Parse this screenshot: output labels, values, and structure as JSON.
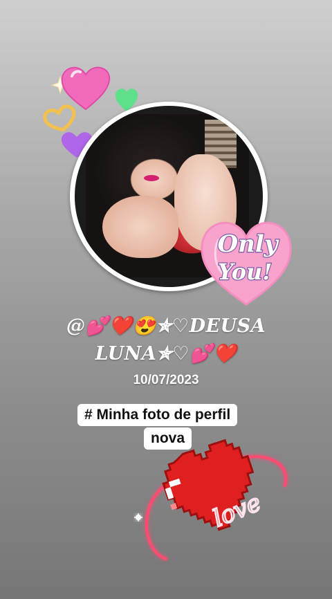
{
  "story": {
    "handle_line1": "@💕❤️😍✯♡DEUSA",
    "handle_line2": "LUNA✯♡💕❤️",
    "date": "10/07/2023",
    "caption_line1": "# Minha foto de perfil",
    "caption_line2": "nova"
  },
  "stickers": {
    "only_you_line1": "Only",
    "only_you_line2": "You!",
    "love_text": "love"
  },
  "colors": {
    "heart_pink": "#f06bb9",
    "heart_green": "#5fe08a",
    "heart_purple": "#b066e8",
    "heart_yellow": "#f2c14e",
    "pixel_red": "#e02020",
    "neon_pink": "#ff4b72"
  },
  "icons": [
    "sparkle-icon",
    "pink-heart-icon",
    "green-heart-icon",
    "yellow-heart-outline-icon",
    "purple-heart-icon",
    "only-you-heart-sticker",
    "pixel-heart-love-sticker"
  ]
}
